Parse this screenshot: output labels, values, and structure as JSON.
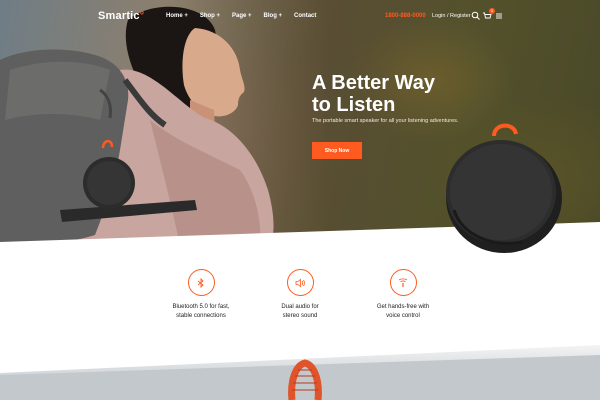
{
  "header": {
    "logo_text": "Smartic",
    "nav": [
      "Home +",
      "Shop +",
      "Page +",
      "Blog +",
      "Contact"
    ],
    "phone": "1800-888-0000",
    "login": "Login / Register",
    "cart_count": "0",
    "icons": [
      "search-icon",
      "cart-icon",
      "menu-icon"
    ]
  },
  "hero": {
    "title_line1": "A Better Way",
    "title_line2": "to Listen",
    "subtitle": "The portable smart speaker for all your listening adventures.",
    "button": "Shop Now"
  },
  "features": [
    {
      "icon": "bluetooth-icon",
      "line1": "Bluetooth 5.0 for fast,",
      "line2": "stable connections"
    },
    {
      "icon": "speaker-icon",
      "line1": "Dual audio for",
      "line2": "stereo sound"
    },
    {
      "icon": "microphone-icon",
      "line1": "Get hands-free with",
      "line2": "voice control"
    }
  ],
  "colors": {
    "accent": "#ff5a1f",
    "text_dark": "#222222",
    "white": "#ffffff"
  }
}
